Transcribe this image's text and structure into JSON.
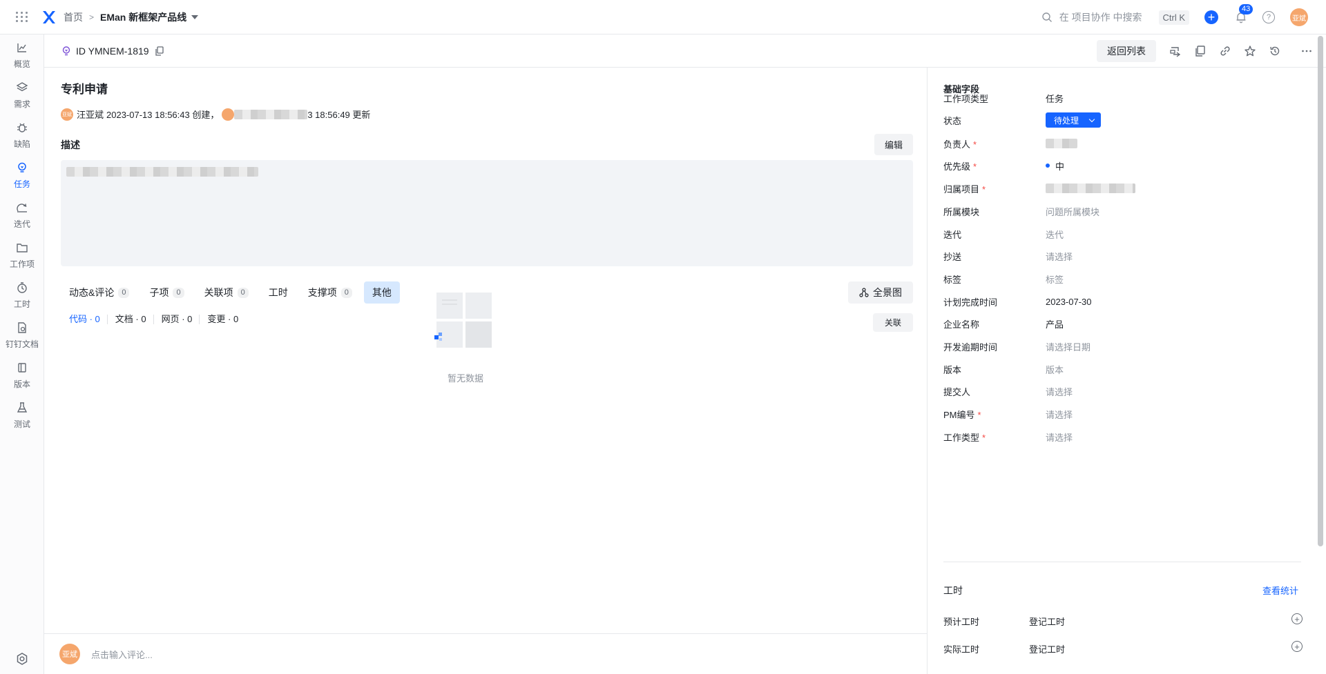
{
  "topbar": {
    "breadcrumb_home": "首页",
    "breadcrumb_sep": ">",
    "project_name": "EMan 新框架产品线",
    "search_placeholder": "在 项目协作 中搜索",
    "shortcut": "Ctrl K",
    "notification_count": "43",
    "help_label": "?",
    "user_avatar": "亚斌"
  },
  "nav": {
    "items": [
      {
        "label": "概览",
        "icon": "chart-line-icon"
      },
      {
        "label": "需求",
        "icon": "layers-icon"
      },
      {
        "label": "缺陷",
        "icon": "bug-icon"
      },
      {
        "label": "任务",
        "icon": "lightbulb-icon"
      },
      {
        "label": "迭代",
        "icon": "iteration-icon"
      },
      {
        "label": "工作项",
        "icon": "folder-icon"
      },
      {
        "label": "工时",
        "icon": "timer-icon"
      },
      {
        "label": "钉钉文档",
        "icon": "document-icon"
      },
      {
        "label": "版本",
        "icon": "version-icon"
      },
      {
        "label": "测试",
        "icon": "flask-icon"
      }
    ],
    "active_index": 3
  },
  "subbar": {
    "item_id": "ID YMNEM-1819",
    "back_label": "返回列表"
  },
  "main": {
    "title": "专利申请",
    "creator_avatar": "亚斌",
    "creator": "汪亚斌",
    "created_at": "2023-07-13 18:56:43 创建，",
    "updated_suffix": "3 18:56:49 更新",
    "desc_label": "描述",
    "edit_label": "编辑",
    "tabs": [
      {
        "label": "动态&评论",
        "count": "0"
      },
      {
        "label": "子项",
        "count": "0"
      },
      {
        "label": "关联项",
        "count": "0"
      },
      {
        "label": "工时",
        "count": null
      },
      {
        "label": "支撑项",
        "count": "0"
      },
      {
        "label": "其他",
        "count": null
      }
    ],
    "active_tab": 5,
    "panorama_label": "全景图",
    "subtabs": [
      "代码 · 0",
      "文档 · 0",
      "网页 · 0",
      "变更 · 0"
    ],
    "link_label": "关联",
    "empty_text": "暂无数据"
  },
  "comment": {
    "avatar": "亚斌",
    "placeholder": "点击输入评论..."
  },
  "panel": {
    "section_title": "基础字段",
    "fields": [
      {
        "label": "工作项类型",
        "value": "任务",
        "required": false,
        "placeholder": false
      },
      {
        "label": "状态",
        "value": "待处理",
        "required": false,
        "placeholder": false
      },
      {
        "label": "负责人",
        "value": "",
        "required": true,
        "placeholder": false
      },
      {
        "label": "优先级",
        "value": "中",
        "required": true,
        "placeholder": false
      },
      {
        "label": "归属项目",
        "value": "",
        "required": true,
        "placeholder": false
      },
      {
        "label": "所属模块",
        "value": "问题所属模块",
        "required": false,
        "placeholder": true
      },
      {
        "label": "迭代",
        "value": "迭代",
        "required": false,
        "placeholder": true
      },
      {
        "label": "抄送",
        "value": "请选择",
        "required": false,
        "placeholder": true
      },
      {
        "label": "标签",
        "value": "标签",
        "required": false,
        "placeholder": true
      },
      {
        "label": "计划完成时间",
        "value": "2023-07-30",
        "required": false,
        "placeholder": false
      },
      {
        "label": "企业名称",
        "value": "产品",
        "required": false,
        "placeholder": false
      },
      {
        "label": "开发逾期时间",
        "value": "请选择日期",
        "required": false,
        "placeholder": true
      },
      {
        "label": "版本",
        "value": "版本",
        "required": false,
        "placeholder": true
      },
      {
        "label": "提交人",
        "value": "请选择",
        "required": false,
        "placeholder": true
      },
      {
        "label": "PM编号",
        "value": "请选择",
        "required": true,
        "placeholder": true
      },
      {
        "label": "工作类型",
        "value": "请选择",
        "required": true,
        "placeholder": true
      }
    ],
    "required_mark": "*",
    "hours_title": "工时",
    "stats_link": "查看统计",
    "hour_rows": [
      {
        "label": "预计工时",
        "action": "登记工时"
      },
      {
        "label": "实际工时",
        "action": "登记工时"
      }
    ]
  },
  "colors": {
    "accent": "#1664ff",
    "avatar": "#f5a66c",
    "active_tab_bg": "#d6e8fe",
    "required": "#f54a45"
  }
}
